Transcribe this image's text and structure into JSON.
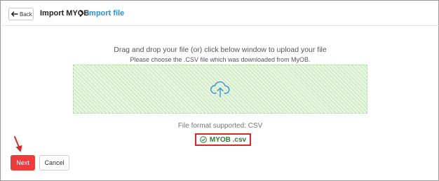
{
  "header": {
    "back_label": "Back",
    "title": "Import MYOB",
    "current": "Import file"
  },
  "upload": {
    "instruction": "Drag and drop your file (or) click below window to upload your file",
    "sub_instruction": "Please choose the .CSV file which was downloaded from MyOB.",
    "icon": "cloud-upload-icon",
    "format_text": "File format supported: CSV",
    "file_name": "MYOB .csv"
  },
  "actions": {
    "next_label": "Next",
    "cancel_label": "Cancel"
  },
  "colors": {
    "accent_blue": "#2a8fd6",
    "next_red": "#ef3b3b",
    "success_green": "#2e7d32",
    "highlight_red": "#d62a2a"
  }
}
